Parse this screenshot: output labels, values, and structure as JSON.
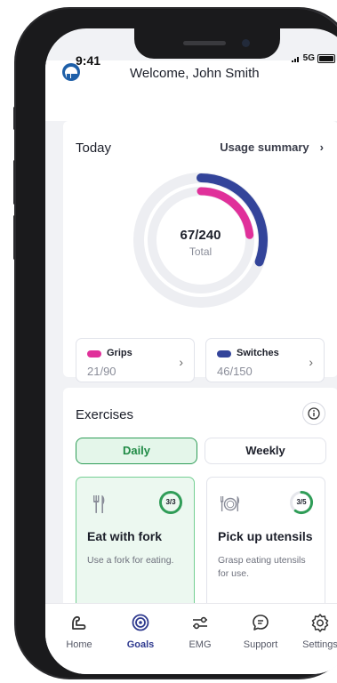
{
  "status": {
    "time": "9:41",
    "network": "5G"
  },
  "header": {
    "welcome": "Welcome, John Smith"
  },
  "today": {
    "title": "Today",
    "usage_link": "Usage summary",
    "total_value": "67/240",
    "total_label": "Total",
    "grips": {
      "label": "Grips",
      "value": "21/90",
      "done": 21,
      "goal": 90,
      "color": "#e0309a"
    },
    "switches": {
      "label": "Switches",
      "value": "46/150",
      "done": 46,
      "goal": 150,
      "color": "#33449a"
    }
  },
  "exercises": {
    "title": "Exercises",
    "tabs": {
      "daily": "Daily",
      "weekly": "Weekly"
    },
    "items": [
      {
        "name": "Eat with fork",
        "desc": "Use a fork for eating.",
        "progress": "3/3",
        "done": 3,
        "goal": 3,
        "icon": "fork-knife-icon"
      },
      {
        "name": "Pick up utensils",
        "desc": "Grasp eating utensils for use.",
        "progress": "3/5",
        "done": 3,
        "goal": 5,
        "icon": "plate-utensils-icon"
      }
    ]
  },
  "tabbar": {
    "home": "Home",
    "goals": "Goals",
    "emg": "EMG",
    "support": "Support",
    "settings": "Settings"
  },
  "colors": {
    "accent": "#2f3a8f",
    "green": "#2f9d57",
    "pink": "#e0309a",
    "navy": "#33449a"
  }
}
